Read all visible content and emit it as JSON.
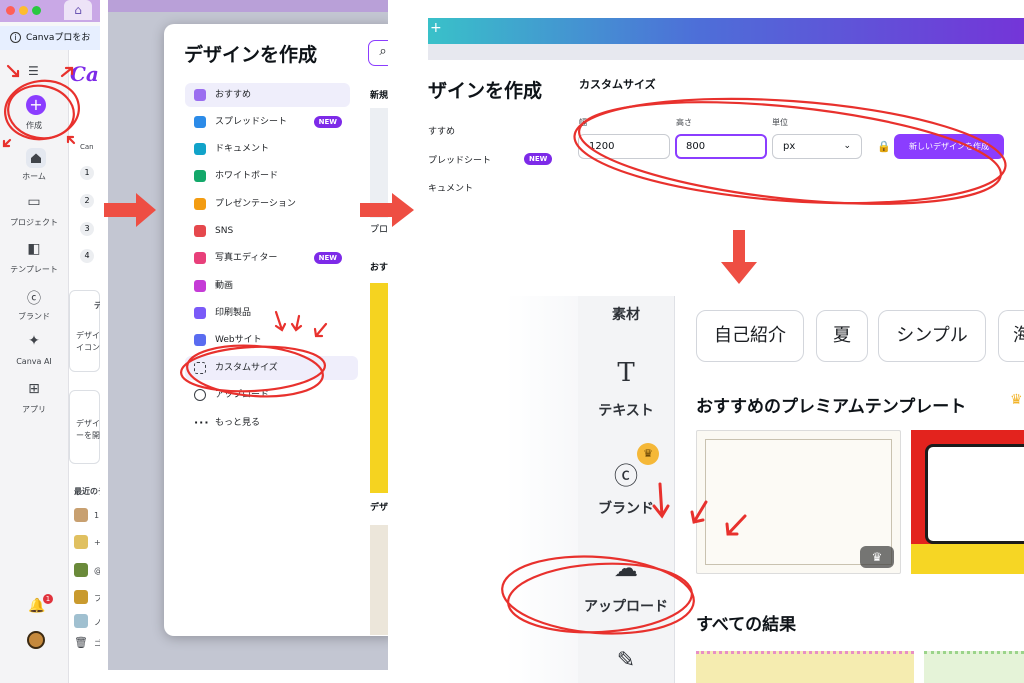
{
  "panel1": {
    "banner_text": "Canvaプロをお",
    "info_icon": "i",
    "home_tab_icon": "⌂",
    "logo_text": "Canva",
    "create_label": "作成",
    "create_plus": "+",
    "nav": [
      {
        "label": "ホーム",
        "icon": "home-icon"
      },
      {
        "label": "プロジェクト",
        "icon": "folder-icon"
      },
      {
        "label": "テンプレート",
        "icon": "template-icon"
      },
      {
        "label": "ブランド",
        "icon": "brand-icon"
      },
      {
        "label": "Canva AI",
        "icon": "sparkle-icon"
      },
      {
        "label": "アプリ",
        "icon": "apps-icon"
      }
    ],
    "nav_icons": [
      "⌂",
      "▭",
      "◧",
      "ⓒ",
      "✦",
      "⊞"
    ],
    "numbers": [
      "1",
      "2",
      "3",
      "4"
    ],
    "card1_lines": [
      "デ",
      "デザイン",
      "イコン"
    ],
    "card2_lines": [
      "デザイ",
      "ーを開い"
    ],
    "recent_label": "最近のデ",
    "recent_items": [
      "1",
      "+",
      "@",
      "フ",
      "ノ"
    ],
    "trash_label": "ゴ",
    "notification_count": "1",
    "snippet": "Can"
  },
  "panel2": {
    "title": "デザインを作成",
    "search_icon": "⌕",
    "menu": [
      {
        "label": "おすすめ",
        "color": "#9b6ef0"
      },
      {
        "label": "スプレッドシート",
        "color": "#2c8be8",
        "new": "NEW"
      },
      {
        "label": "ドキュメント",
        "color": "#11a3c9"
      },
      {
        "label": "ホワイトボード",
        "color": "#13a86a"
      },
      {
        "label": "プレゼンテーション",
        "color": "#f39c12"
      },
      {
        "label": "SNS",
        "color": "#e5484d"
      },
      {
        "label": "写真エディター",
        "color": "#e8407a",
        "new": "NEW"
      },
      {
        "label": "動画",
        "color": "#c53bd6"
      },
      {
        "label": "印刷製品",
        "color": "#7a5af8"
      },
      {
        "label": "Webサイト",
        "color": "#5a6cf0"
      },
      {
        "label": "カスタムサイズ",
        "color": "#3a3f46"
      },
      {
        "label": "アップロード",
        "color": "#3a3f46"
      },
      {
        "label": "もっと見る",
        "color": "#3a3f46"
      }
    ],
    "right_heads": [
      "新規",
      "プロ",
      "おす",
      "デザ"
    ]
  },
  "panel3": {
    "title": "ザインを作成",
    "section_label": "カスタムサイズ",
    "left_items": [
      "すすめ",
      "プレッドシート",
      "キュメント"
    ],
    "new_badge": "NEW",
    "width_label": "幅",
    "height_label": "高さ",
    "unit_label": "単位",
    "width_value": "1200",
    "height_value": "800",
    "unit_value": "px",
    "caret": "⌄",
    "lock_icon": "🔒",
    "create_button": "新しいデザインを作成",
    "tab_plus": "+"
  },
  "panel4": {
    "rail": [
      {
        "label": "素材"
      },
      {
        "label": "テキスト",
        "glyph": "T"
      },
      {
        "label": "ブランド",
        "glyph": "ⓒ"
      },
      {
        "label": "アップロード",
        "glyph": "☁"
      }
    ],
    "crown": "♛",
    "chips": [
      "自己紹介",
      "夏",
      "シンプル",
      "海"
    ],
    "section_title": "おすすめのプレミアムテンプレート",
    "all_results": "すべての結果"
  },
  "colors": {
    "brand_purple": "#8b3dff",
    "annotation_red": "#e8312d",
    "arrow_red": "#ee4e43"
  }
}
